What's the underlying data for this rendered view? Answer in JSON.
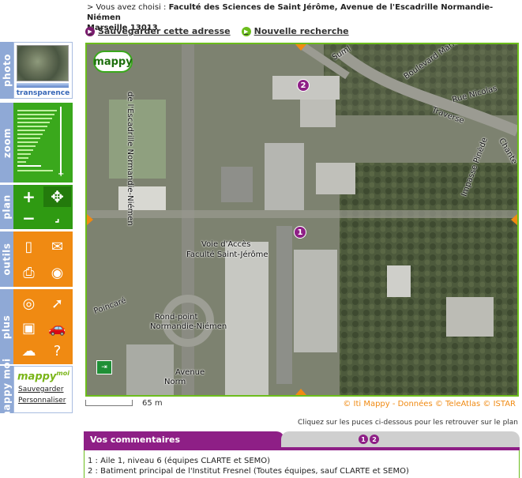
{
  "header": {
    "prefix": "> Vous avez choisi :",
    "address_line1": "Faculté des Sciences de Saint Jérôme, Avenue de l'Escadrille Normandie-Niémen",
    "address_line2": "Marseille 13013"
  },
  "actions": {
    "save": "Sauvegarder cette adresse",
    "new_search": "Nouvelle recherche"
  },
  "sidebar": {
    "photo": {
      "label": "photo",
      "transparency": "transparence"
    },
    "zoom": {
      "label": "zoom"
    },
    "plan": {
      "label": "plan"
    },
    "outils": {
      "label": "outils"
    },
    "plus": {
      "label": "plus"
    },
    "mappymoi": {
      "label": "mappy moi",
      "logo": "mappy",
      "logo_sup": "moi",
      "save_link": "Sauvegarder",
      "personalize_link": "Personnaliser"
    }
  },
  "map": {
    "logo": "mappy",
    "markers": [
      {
        "label": "1"
      },
      {
        "label": "2"
      }
    ],
    "streets": {
      "escadrille": "de l'Escadrille Normandie-Niémen",
      "boulevard": "Boulevard Mariés",
      "rue_nicolas": "Rue Nicolas",
      "traverse": "Traverse",
      "impasse": "Impasse Pinède",
      "voie": "Voie d'Accès",
      "faculte": "Faculté Saint-Jérôme",
      "rondpoint": "Rond-point",
      "rondpoint2": "Normandie-Niémen",
      "avenue": "Avenue",
      "avenue2": "Norm",
      "poincare": "Poincaré",
      "chante": "Chante",
      "suml": "Suml"
    },
    "exit_icon": "exit-sign-icon",
    "scale_label": "65 m",
    "copyright": "© Iti Mappy - Données © TeleAtlas © ISTAR"
  },
  "hint": "Cliquez sur les puces ci-dessous pour les retrouver sur le plan",
  "comments": {
    "title": "Vos commentaires",
    "items": [
      "1 : Aile 1, niveau 6 (équipes CLARTE et SEMO)",
      "2 : Batiment principal de l'Institut Fresnel (Toutes équipes, sauf CLARTE et SEMO)"
    ]
  },
  "colors": {
    "purple": "#8e1f86",
    "green": "#6cbd1c",
    "orange": "#f08a12",
    "sidebar_blue": "#8fa9d6"
  }
}
